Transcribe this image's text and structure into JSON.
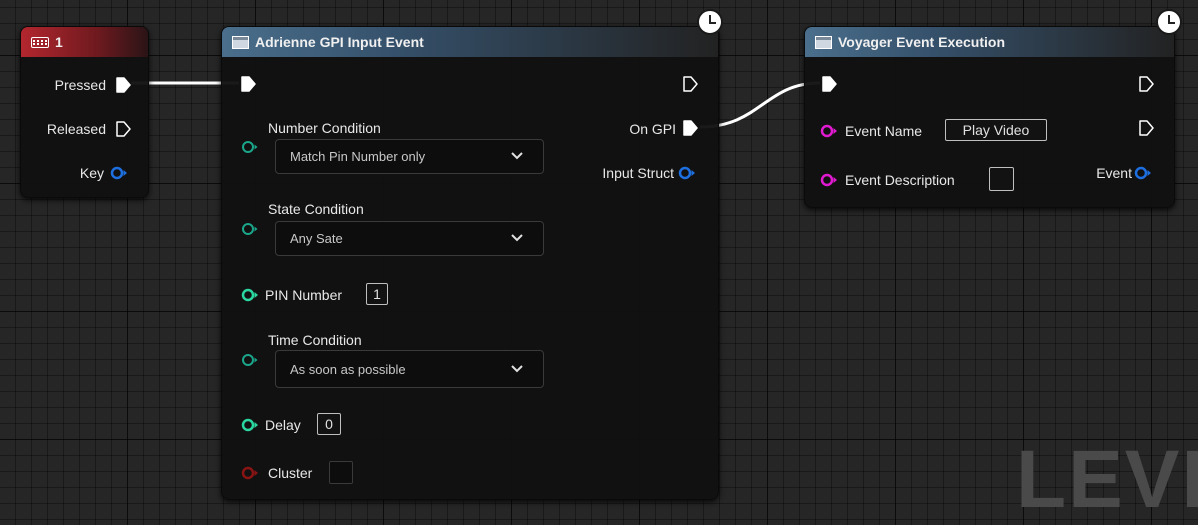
{
  "keyboard_node": {
    "title": "1",
    "pins": {
      "pressed": "Pressed",
      "released": "Released",
      "key": "Key"
    }
  },
  "gpi_node": {
    "title": "Adrienne GPI Input Event",
    "number_condition": {
      "label": "Number Condition",
      "value": "Match Pin Number only"
    },
    "state_condition": {
      "label": "State Condition",
      "value": "Any Sate"
    },
    "pin_number": {
      "label": "PIN Number",
      "value": "1"
    },
    "time_condition": {
      "label": "Time Condition",
      "value": "As soon as possible"
    },
    "delay": {
      "label": "Delay",
      "value": "0"
    },
    "cluster": {
      "label": "Cluster",
      "value": ""
    },
    "outputs": {
      "on_gpi": "On GPI",
      "input_struct": "Input Struct"
    }
  },
  "voyager_node": {
    "title": "Voyager Event Execution",
    "event_name": {
      "label": "Event Name",
      "value": "Play Video"
    },
    "event_description": {
      "label": "Event Description",
      "value": ""
    },
    "outputs": {
      "event": "Event"
    }
  },
  "watermark": "LEVE",
  "icons": {
    "keyboard": "keyboard-icon",
    "function": "function-icon",
    "clock": "clock-icon",
    "exec_pin": "exec-pin-icon",
    "data_pin": "data-pin-icon",
    "dropdown": "chevron-down-icon"
  },
  "colors": {
    "exec_pin": "#ffffff",
    "struct_pin": "#1e6fe0",
    "enum_pin": "#1aa68a",
    "int_pin": "#2bd7a0",
    "string_pin": "#e01ad0",
    "object_pin": "#8a1414"
  }
}
